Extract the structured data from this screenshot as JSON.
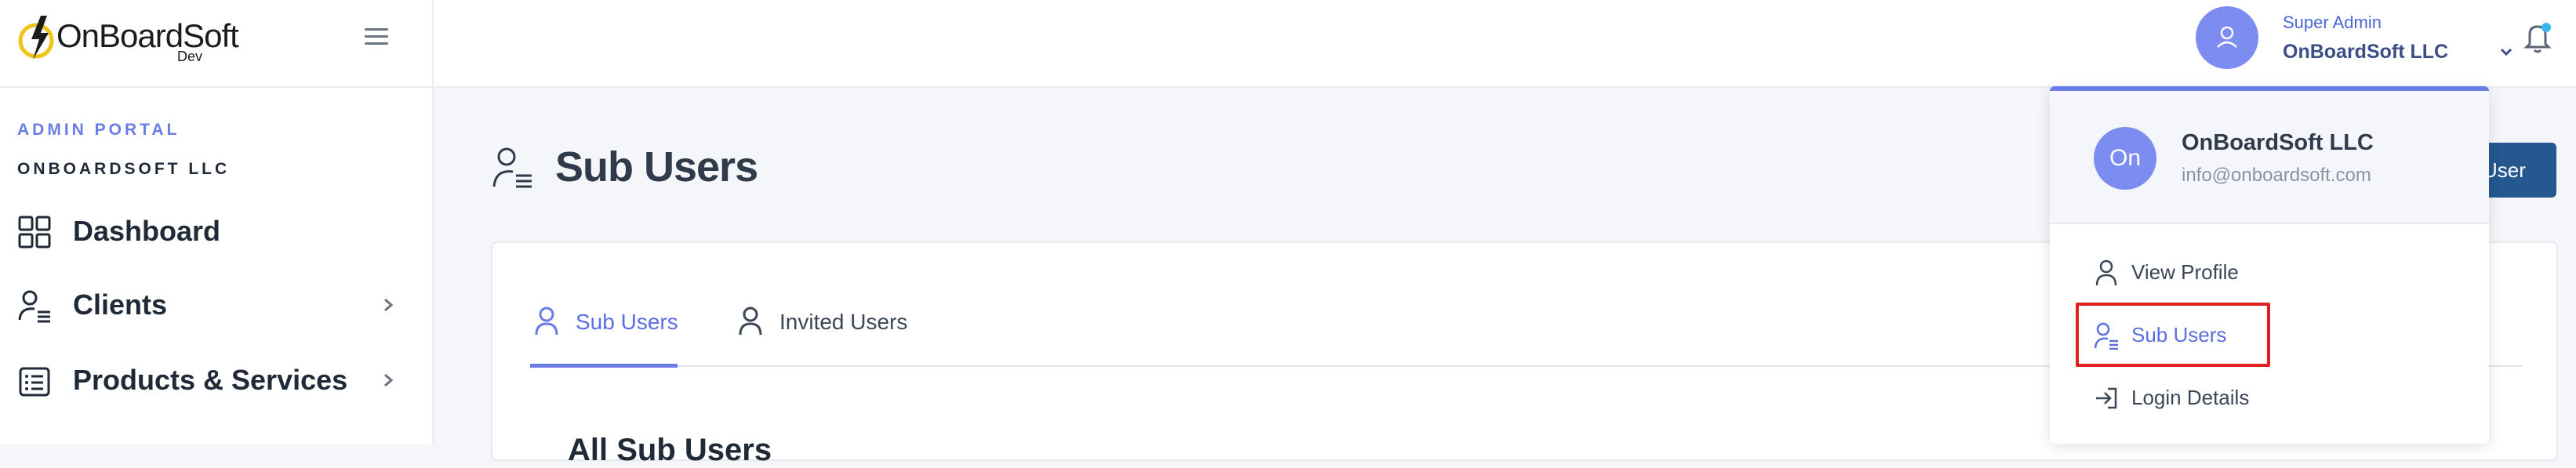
{
  "brand": {
    "logo_text": "OnBoardSoft",
    "logo_sub": "Dev"
  },
  "header": {
    "user_role": "Super Admin",
    "user_company": "OnBoardSoft LLC"
  },
  "sidebar": {
    "portal_label": "ADMIN PORTAL",
    "company": "ONBOARDSOFT LLC",
    "items": [
      {
        "label": "Dashboard",
        "icon": "dashboard-grid-icon"
      },
      {
        "label": "Clients",
        "icon": "user-list-icon"
      },
      {
        "label": "Products & Services",
        "icon": "list-icon"
      }
    ]
  },
  "main": {
    "page_title": "Sub Users",
    "add_button_partial": "User",
    "tabs": [
      {
        "label": "Sub Users",
        "active": true
      },
      {
        "label": "Invited Users",
        "active": false
      }
    ],
    "section_title": "All Sub Users"
  },
  "dropdown": {
    "avatar_initials": "On",
    "company": "OnBoardSoft LLC",
    "email": "info@onboardsoft.com",
    "items": [
      {
        "label": "View Profile",
        "icon": "user-icon"
      },
      {
        "label": "Sub Users",
        "icon": "user-list-icon",
        "active": true
      },
      {
        "label": "Login Details",
        "icon": "login-icon"
      }
    ]
  },
  "colors": {
    "accent": "#6a7de6",
    "button": "#24588e",
    "highlight": "#e0201e"
  }
}
